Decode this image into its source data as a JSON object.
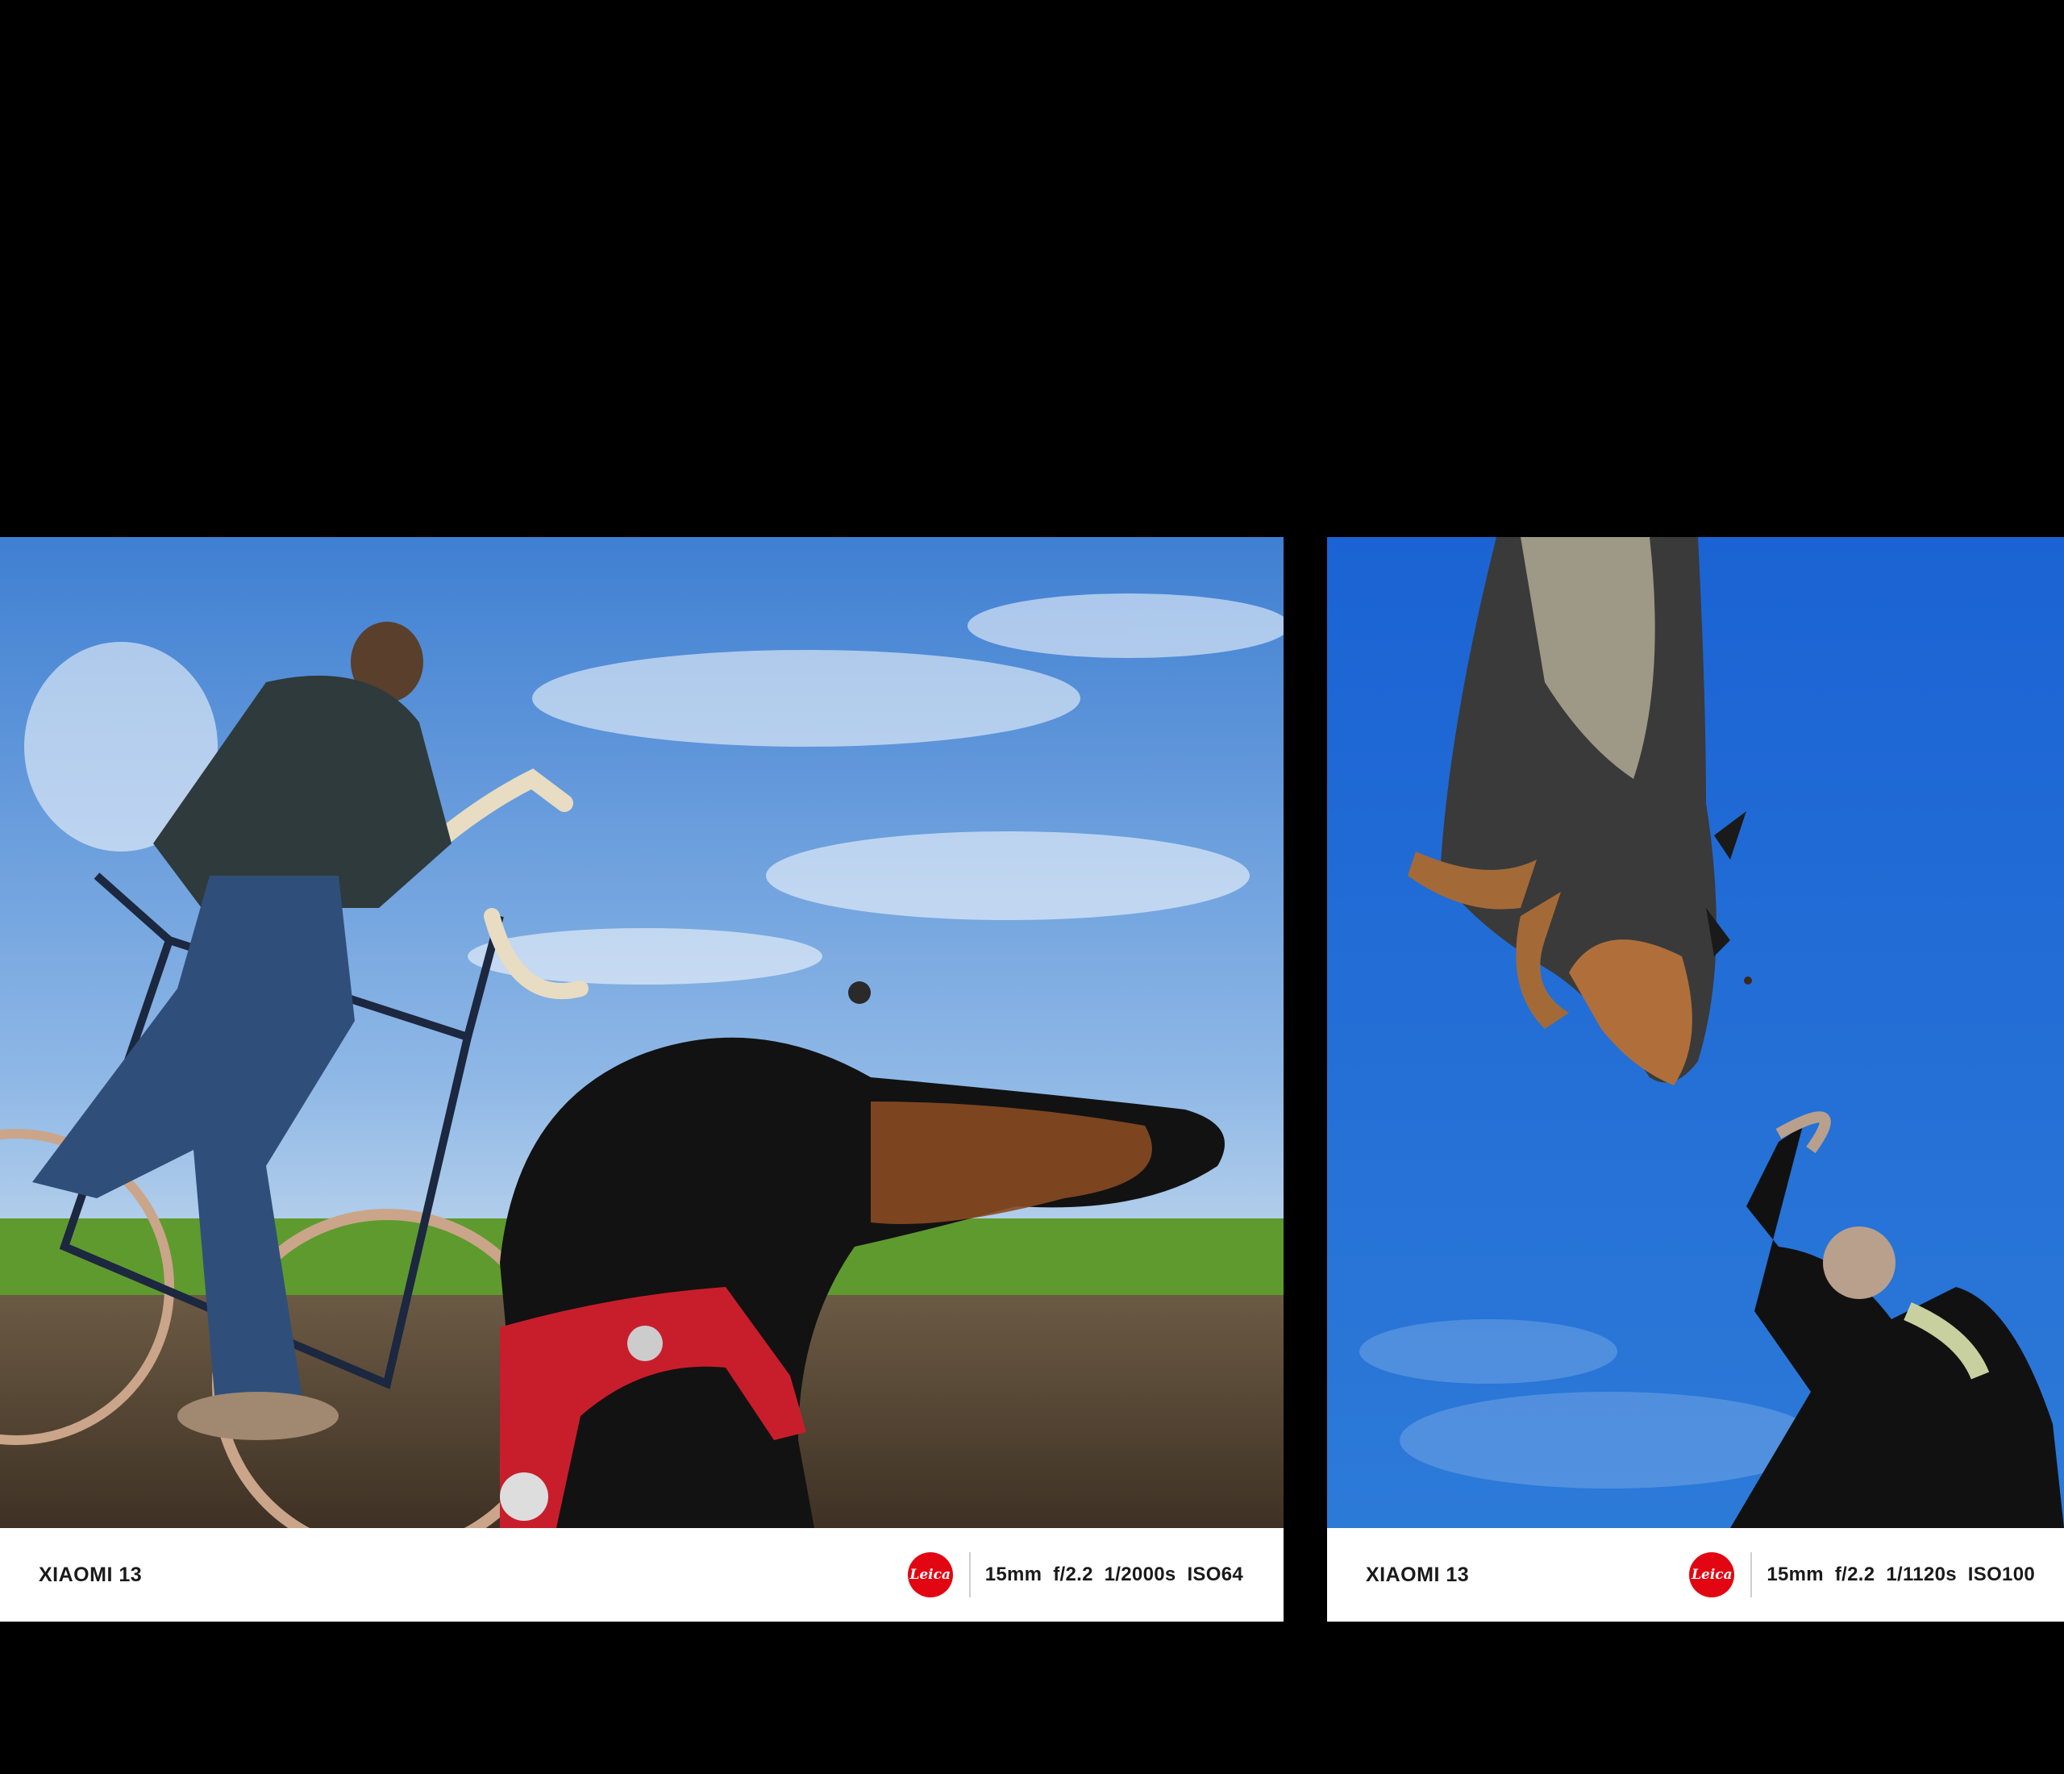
{
  "photos": [
    {
      "brand": "XIAOMI 13",
      "logo": "Leica",
      "exif": "15mm  f/2.2  1/2000s  ISO64",
      "scene": "cyclist-and-dog"
    },
    {
      "brand": "XIAOMI 13",
      "logo": "Leica",
      "exif": "15mm  f/2.2  1/1120s  ISO100",
      "scene": "dog-jumping-overhead"
    }
  ],
  "colors": {
    "leica_red": "#e20612",
    "sky": "#1e6fd8",
    "background": "#000000"
  }
}
